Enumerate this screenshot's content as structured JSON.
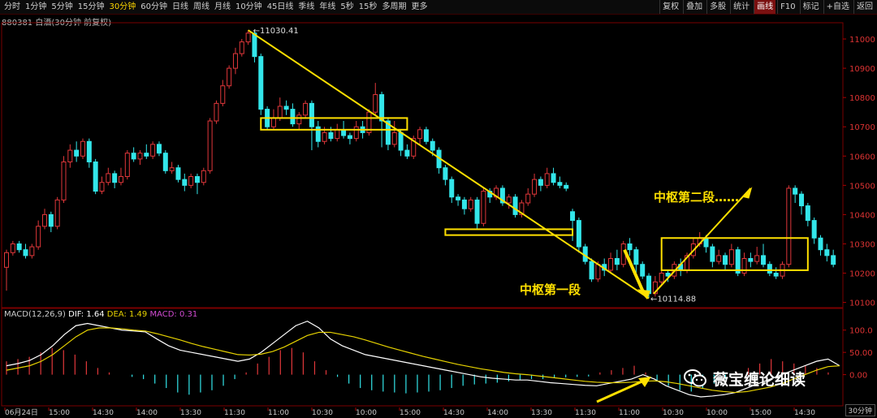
{
  "toolbar": {
    "left_items": [
      "分时",
      "1分钟",
      "5分钟",
      "15分钟",
      "30分钟",
      "60分钟",
      "日线",
      "周线",
      "月线",
      "10分钟",
      "45日线",
      "季线",
      "年线",
      "5秒",
      "15秒",
      "多周期",
      "更多"
    ],
    "active_left": "30分钟",
    "right_items": [
      "复权",
      "叠加",
      "多股",
      "统计",
      "画线",
      "F10",
      "标记",
      "+自选",
      "返回"
    ],
    "active_right": "画线"
  },
  "stock_title": "880381 白酒(30分钟 前复权)",
  "price_axis": {
    "ticks": [
      "11000",
      "10900",
      "10800",
      "10700",
      "10600",
      "10500",
      "10400",
      "10300",
      "10200",
      "10100"
    ]
  },
  "macd": {
    "label": "MACD(12,26,9)",
    "dif": "DIF: 1.64",
    "dea": "DEA: 1.49",
    "macd": "MACD: 0.31",
    "ticks": [
      "100.0",
      "50.00",
      "0.00"
    ]
  },
  "time_axis": [
    "06月24日",
    "15:00",
    "14:30",
    "14:00",
    "13:30",
    "11:30",
    "11:00",
    "10:30",
    "10:00",
    "15:00",
    "14:30",
    "14:00",
    "13:30",
    "11:30",
    "11:00",
    "10:30",
    "10:00",
    "15:00",
    "14:30"
  ],
  "period_badge": "30分钟",
  "annotations": {
    "high": "11030.41",
    "low": "10114.88",
    "segment1": "中枢第一段",
    "segment2": "中枢第二段……"
  },
  "watermark": "薇宝缠论细读",
  "colors": {
    "up": "#e0373a",
    "down": "#33e6ea",
    "highlight": "#ffe000",
    "dif": "#ffffff",
    "dea": "#e6d200"
  },
  "chart_data": {
    "type": "candlestick",
    "candles": [
      [
        10220,
        10270,
        10280,
        10140
      ],
      [
        10270,
        10300,
        10310,
        10260
      ],
      [
        10300,
        10280,
        10310,
        10270
      ],
      [
        10280,
        10260,
        10300,
        10250
      ],
      [
        10260,
        10290,
        10300,
        10250
      ],
      [
        10290,
        10360,
        10380,
        10280
      ],
      [
        10360,
        10400,
        10420,
        10350
      ],
      [
        10400,
        10360,
        10410,
        10340
      ],
      [
        10360,
        10450,
        10460,
        10350
      ],
      [
        10450,
        10580,
        10600,
        10440
      ],
      [
        10580,
        10620,
        10640,
        10560
      ],
      [
        10620,
        10600,
        10650,
        10580
      ],
      [
        10600,
        10650,
        10660,
        10590
      ],
      [
        10650,
        10580,
        10660,
        10560
      ],
      [
        10580,
        10480,
        10590,
        10470
      ],
      [
        10480,
        10510,
        10530,
        10470
      ],
      [
        10510,
        10540,
        10560,
        10500
      ],
      [
        10540,
        10510,
        10550,
        10490
      ],
      [
        10510,
        10530,
        10560,
        10500
      ],
      [
        10530,
        10610,
        10620,
        10520
      ],
      [
        10610,
        10590,
        10630,
        10580
      ],
      [
        10590,
        10610,
        10620,
        10570
      ],
      [
        10610,
        10600,
        10640,
        10590
      ],
      [
        10600,
        10640,
        10650,
        10590
      ],
      [
        10640,
        10610,
        10650,
        10600
      ],
      [
        10610,
        10550,
        10620,
        10540
      ],
      [
        10550,
        10560,
        10580,
        10540
      ],
      [
        10560,
        10520,
        10570,
        10510
      ],
      [
        10520,
        10500,
        10540,
        10480
      ],
      [
        10500,
        10530,
        10540,
        10490
      ],
      [
        10530,
        10510,
        10540,
        10470
      ],
      [
        10510,
        10550,
        10560,
        10500
      ],
      [
        10550,
        10720,
        10730,
        10540
      ],
      [
        10720,
        10780,
        10790,
        10710
      ],
      [
        10780,
        10840,
        10860,
        10770
      ],
      [
        10840,
        10900,
        10910,
        10830
      ],
      [
        10900,
        10950,
        10970,
        10880
      ],
      [
        10950,
        10990,
        11000,
        10940
      ],
      [
        10990,
        11020,
        11030,
        10980
      ],
      [
        11020,
        10940,
        11025,
        10920
      ],
      [
        10940,
        10760,
        10950,
        10740
      ],
      [
        10760,
        10700,
        10770,
        10690
      ],
      [
        10700,
        10730,
        10760,
        10690
      ],
      [
        10730,
        10770,
        10800,
        10720
      ],
      [
        10770,
        10760,
        10790,
        10740
      ],
      [
        10760,
        10710,
        10780,
        10700
      ],
      [
        10710,
        10740,
        10750,
        10690
      ],
      [
        10740,
        10780,
        10790,
        10730
      ],
      [
        10780,
        10700,
        10790,
        10620
      ],
      [
        10700,
        10650,
        10720,
        10630
      ],
      [
        10650,
        10680,
        10700,
        10640
      ],
      [
        10680,
        10660,
        10700,
        10650
      ],
      [
        10660,
        10690,
        10710,
        10650
      ],
      [
        10690,
        10670,
        10720,
        10660
      ],
      [
        10670,
        10660,
        10680,
        10640
      ],
      [
        10660,
        10700,
        10720,
        10650
      ],
      [
        10700,
        10680,
        10720,
        10660
      ],
      [
        10680,
        10750,
        10760,
        10670
      ],
      [
        10750,
        10810,
        10850,
        10740
      ],
      [
        10810,
        10720,
        10820,
        10630
      ],
      [
        10720,
        10640,
        10730,
        10620
      ],
      [
        10640,
        10680,
        10720,
        10630
      ],
      [
        10680,
        10620,
        10690,
        10600
      ],
      [
        10620,
        10600,
        10640,
        10590
      ],
      [
        10600,
        10660,
        10670,
        10590
      ],
      [
        10660,
        10690,
        10700,
        10640
      ],
      [
        10690,
        10650,
        10700,
        10640
      ],
      [
        10650,
        10620,
        10660,
        10600
      ],
      [
        10620,
        10560,
        10630,
        10540
      ],
      [
        10560,
        10520,
        10570,
        10500
      ],
      [
        10520,
        10460,
        10530,
        10440
      ],
      [
        10460,
        10450,
        10470,
        10430
      ],
      [
        10450,
        10420,
        10460,
        10400
      ],
      [
        10420,
        10450,
        10460,
        10410
      ],
      [
        10450,
        10370,
        10460,
        10350
      ],
      [
        10370,
        10480,
        10490,
        10360
      ],
      [
        10480,
        10460,
        10490,
        10440
      ],
      [
        10460,
        10490,
        10500,
        10450
      ],
      [
        10490,
        10440,
        10500,
        10430
      ],
      [
        10440,
        10460,
        10470,
        10420
      ],
      [
        10460,
        10400,
        10470,
        10390
      ],
      [
        10400,
        10440,
        10450,
        10390
      ],
      [
        10440,
        10470,
        10490,
        10430
      ],
      [
        10470,
        10520,
        10540,
        10460
      ],
      [
        10520,
        10500,
        10530,
        10480
      ],
      [
        10500,
        10540,
        10560,
        10490
      ],
      [
        10540,
        10510,
        10560,
        10500
      ],
      [
        10510,
        10500,
        10530,
        10490
      ],
      [
        10500,
        10490,
        10510,
        10480
      ],
      [
        10410,
        10380,
        10420,
        10310
      ],
      [
        10380,
        10290,
        10390,
        10270
      ],
      [
        10290,
        10240,
        10300,
        10230
      ],
      [
        10240,
        10180,
        10250,
        10170
      ],
      [
        10180,
        10230,
        10240,
        10170
      ],
      [
        10230,
        10210,
        10250,
        10190
      ],
      [
        10210,
        10250,
        10270,
        10200
      ],
      [
        10250,
        10230,
        10280,
        10210
      ],
      [
        10230,
        10300,
        10310,
        10220
      ],
      [
        10300,
        10280,
        10320,
        10260
      ],
      [
        10280,
        10230,
        10290,
        10200
      ],
      [
        10230,
        10190,
        10240,
        10180
      ],
      [
        10190,
        10130,
        10200,
        10115
      ],
      [
        10130,
        10170,
        10190,
        10120
      ],
      [
        10170,
        10200,
        10220,
        10160
      ],
      [
        10200,
        10190,
        10210,
        10170
      ],
      [
        10190,
        10230,
        10240,
        10180
      ],
      [
        10230,
        10210,
        10250,
        10190
      ],
      [
        10210,
        10260,
        10270,
        10200
      ],
      [
        10260,
        10300,
        10320,
        10250
      ],
      [
        10300,
        10320,
        10340,
        10290
      ],
      [
        10320,
        10290,
        10330,
        10270
      ],
      [
        10290,
        10240,
        10300,
        10220
      ],
      [
        10240,
        10260,
        10280,
        10230
      ],
      [
        10260,
        10230,
        10270,
        10210
      ],
      [
        10230,
        10280,
        10300,
        10220
      ],
      [
        10280,
        10200,
        10290,
        10190
      ],
      [
        10200,
        10250,
        10270,
        10190
      ],
      [
        10250,
        10240,
        10270,
        10220
      ],
      [
        10240,
        10260,
        10290,
        10230
      ],
      [
        10260,
        10230,
        10300,
        10220
      ],
      [
        10230,
        10200,
        10240,
        10190
      ],
      [
        10200,
        10190,
        10220,
        10180
      ],
      [
        10190,
        10230,
        10240,
        10180
      ],
      [
        10230,
        10490,
        10500,
        10220
      ],
      [
        10490,
        10470,
        10500,
        10440
      ],
      [
        10470,
        10430,
        10480,
        10400
      ],
      [
        10430,
        10380,
        10440,
        10360
      ],
      [
        10380,
        10320,
        10390,
        10300
      ],
      [
        10320,
        10280,
        10330,
        10260
      ],
      [
        10280,
        10260,
        10300,
        10240
      ],
      [
        10260,
        10230,
        10280,
        10220
      ]
    ],
    "macd_dif": [
      20,
      25,
      32,
      45,
      65,
      90,
      110,
      115,
      110,
      105,
      100,
      98,
      96,
      80,
      65,
      55,
      50,
      45,
      40,
      35,
      30,
      35,
      50,
      70,
      90,
      110,
      120,
      105,
      80,
      65,
      55,
      45,
      40,
      35,
      30,
      25,
      20,
      15,
      10,
      5,
      0,
      -5,
      -8,
      -10,
      -12,
      -12,
      -15,
      -18,
      -20,
      -22,
      -24,
      -25,
      -20,
      -15,
      -10,
      0,
      -10,
      -25,
      -35,
      -45,
      -50,
      -48,
      -45,
      -40,
      -30,
      -20,
      -10,
      0,
      10,
      20,
      30,
      35,
      20
    ],
    "macd_dea": [
      10,
      15,
      20,
      30,
      45,
      65,
      85,
      100,
      105,
      105,
      103,
      100,
      98,
      92,
      85,
      78,
      70,
      63,
      57,
      51,
      45,
      44,
      46,
      52,
      62,
      75,
      88,
      95,
      95,
      90,
      85,
      78,
      70,
      62,
      55,
      48,
      41,
      35,
      29,
      23,
      18,
      13,
      9,
      5,
      2,
      0,
      -3,
      -6,
      -9,
      -12,
      -15,
      -17,
      -18,
      -18,
      -17,
      -15,
      -14,
      -16,
      -20,
      -25,
      -30,
      -35,
      -38,
      -40,
      -38,
      -33,
      -28,
      -20,
      -10,
      0,
      10,
      18,
      20
    ],
    "macd_hist": [
      30,
      35,
      40,
      50,
      60,
      55,
      45,
      30,
      15,
      5,
      0,
      -5,
      -10,
      -20,
      -30,
      -40,
      -45,
      -40,
      -35,
      -25,
      -10,
      5,
      25,
      40,
      55,
      60,
      50,
      30,
      10,
      -5,
      -20,
      -30,
      -35,
      -38,
      -40,
      -42,
      -40,
      -38,
      -35,
      -30,
      -25,
      -22,
      -20,
      -18,
      -15,
      -12,
      -10,
      -10,
      -8,
      -6,
      -5,
      -4,
      5,
      10,
      15,
      20,
      5,
      -15,
      -25,
      -35,
      -38,
      -30,
      -20,
      -10,
      5,
      15,
      25,
      35,
      30,
      25,
      20,
      15,
      5
    ]
  }
}
